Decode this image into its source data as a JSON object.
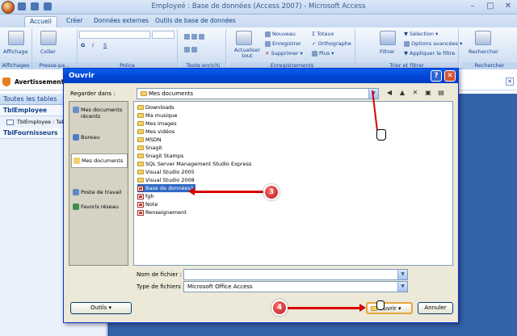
{
  "window": {
    "title": "Employeé : Base de données (Access 2007) - Microsoft Access",
    "minimize": "–",
    "maximize": "□",
    "close": "✕"
  },
  "tabs": [
    "Accueil",
    "Créer",
    "Données externes",
    "Outils de base de données"
  ],
  "ribbon": {
    "groups": {
      "affichages": "Affichages",
      "presse": "Presse-pa...",
      "police": "Police",
      "texte": "Texte enrichi",
      "enregistrements": "Enregistrements",
      "trier": "Trier et filtrer",
      "rechercher": "Rechercher"
    },
    "affichage": "Affichage",
    "coller": "Coller",
    "actualiser": "Actualiser tout",
    "nouveau": "Nouveau",
    "enregistrer": "Enregistrer",
    "supprimer": "Supprimer",
    "totaux": "Totaux",
    "orthographe": "Orthographe",
    "plus": "Plus",
    "filtrer": "Filtrer",
    "selection": "Sélection",
    "options_avancees": "Options avancées",
    "appliquer": "Appliquer le filtre",
    "rechercher_btn": "Rechercher",
    "bold": "G",
    "italic": "I",
    "underline": "S"
  },
  "security_bar": {
    "text": "Avertissement de s"
  },
  "navigation": {
    "header": "Toutes les tables",
    "groups": [
      {
        "name": "TblEmployee",
        "items": [
          "TblEmployee : Tab"
        ]
      },
      {
        "name": "TblFournisseurs",
        "items": []
      }
    ]
  },
  "dialog": {
    "title": "Ouvrir",
    "help": "?",
    "close": "✕",
    "look_in_label": "Regarder dans :",
    "look_in_value": "Mes documents",
    "places": [
      "Mes documents récents",
      "Bureau",
      "Mes documents",
      "Poste de travail",
      "Favoris réseau"
    ],
    "files": [
      "Downloads",
      "Ma musique",
      "Mes images",
      "Mes vidéos",
      "MSDN",
      "Snagit",
      "Snagit Stamps",
      "SQL Server Management Studio Express",
      "Visual Studio 2005",
      "Visual Studio 2008",
      "Base de données1",
      "fgh",
      "Note",
      "Renseignement"
    ],
    "selected_file": "Base de données1",
    "filename_label": "Nom de fichier :",
    "filename_value": "",
    "filetype_label": "Type de fichiers :",
    "filetype_value": "Microsoft Office Access",
    "tools_button": "Outils",
    "open_button": "Ouvrir",
    "cancel_button": "Annuler"
  },
  "annotations": {
    "step3": "3",
    "step4": "4"
  },
  "colors": {
    "dialog_title": "#0146d9",
    "selection": "#316ac5",
    "annotation": "#d90000",
    "workspace": "#3462a8"
  }
}
